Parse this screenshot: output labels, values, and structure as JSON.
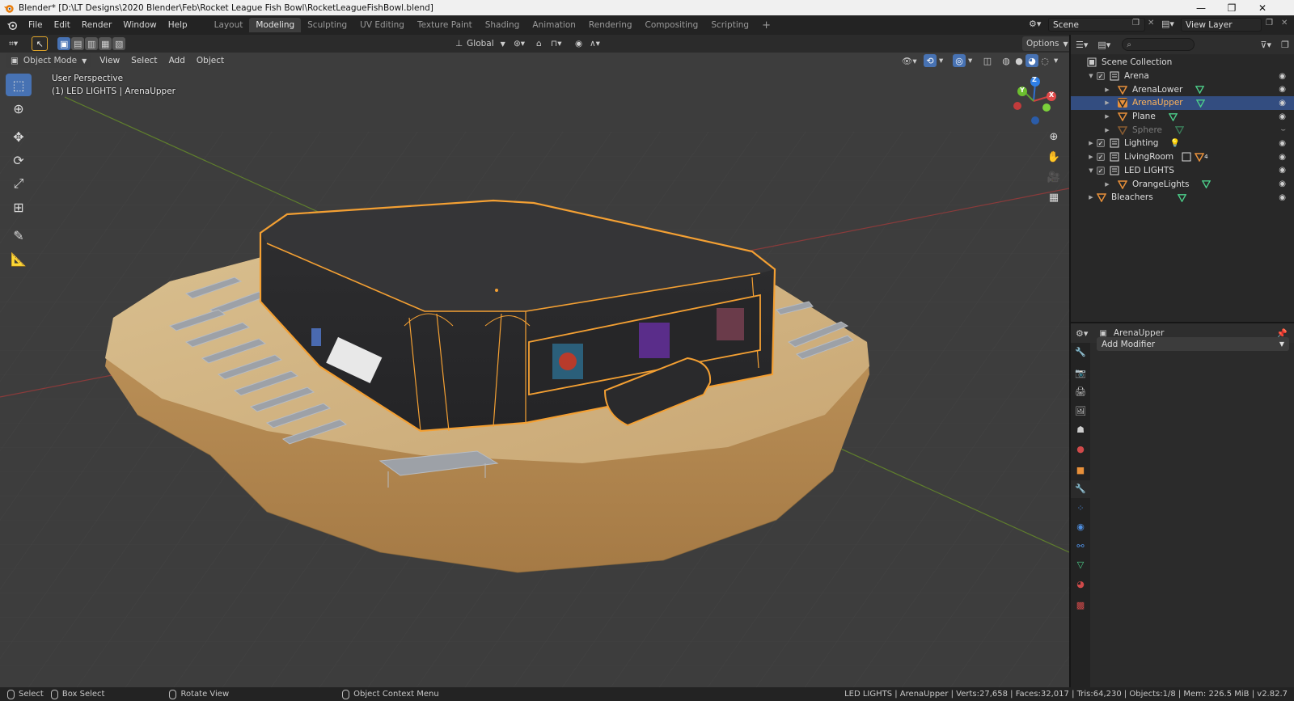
{
  "window": {
    "title": "Blender* [D:\\LT Designs\\2020 Blender\\Feb\\Rocket League Fish Bowl\\RocketLeagueFishBowl.blend]",
    "minimize": "—",
    "restore": "❐",
    "close": "✕"
  },
  "menu": [
    "File",
    "Edit",
    "Render",
    "Window",
    "Help"
  ],
  "workspaces": [
    "Layout",
    "Modeling",
    "Sculpting",
    "UV Editing",
    "Texture Paint",
    "Shading",
    "Animation",
    "Rendering",
    "Compositing",
    "Scripting"
  ],
  "active_workspace": "Modeling",
  "add_workspace": "+",
  "scene": {
    "label": "Scene",
    "view_layer": "View Layer"
  },
  "viewport_header": {
    "transform_orientation": "Global",
    "options": "Options",
    "mode": "Object Mode",
    "menus": [
      "View",
      "Select",
      "Add",
      "Object"
    ]
  },
  "viewport_overlay": {
    "perspective": "User Perspective",
    "collection_info": "(1) LED LIGHTS | ArenaUpper",
    "gizmo": {
      "z": "Z",
      "x": "X",
      "y": "Y"
    }
  },
  "outliner": {
    "root": "Scene Collection",
    "search_placeholder": "",
    "rows": [
      {
        "name": "Arena",
        "type": "collection",
        "depth": 1
      },
      {
        "name": "ArenaLower",
        "type": "object",
        "depth": 2
      },
      {
        "name": "ArenaUpper",
        "type": "object",
        "depth": 2,
        "selected": true
      },
      {
        "name": "Plane",
        "type": "object",
        "depth": 2
      },
      {
        "name": "Sphere",
        "type": "object",
        "depth": 2,
        "dim": true
      },
      {
        "name": "Lighting",
        "type": "collection",
        "depth": 1
      },
      {
        "name": "LivingRoom",
        "type": "collection",
        "depth": 1,
        "badge": "4"
      },
      {
        "name": "LED LIGHTS",
        "type": "collection",
        "depth": 1
      },
      {
        "name": "OrangeLights",
        "type": "object",
        "depth": 2
      },
      {
        "name": "Bleachers",
        "type": "object",
        "depth": 1
      }
    ]
  },
  "properties": {
    "object_name": "ArenaUpper",
    "add_modifier": "Add Modifier",
    "tab_icons": [
      "tool-icon",
      "render-icon",
      "output-icon",
      "view-layer-icon",
      "scene-icon",
      "world-icon",
      "object-icon",
      "modifier-icon",
      "particles-icon",
      "physics-icon",
      "constraints-icon",
      "data-icon",
      "material-icon",
      "texture-icon"
    ]
  },
  "statusbar": {
    "select": "Select",
    "box_select": "Box Select",
    "rotate_view": "Rotate View",
    "context_menu": "Object Context Menu",
    "stats": "LED LIGHTS | ArenaUpper | Verts:27,658 | Faces:32,017 | Tris:64,230 | Objects:1/8 | Mem: 226.5 MiB | v2.82.7"
  },
  "colors": {
    "accent_blue": "#4772b3",
    "selection_orange": "#f4a033",
    "viewport_bg": "#3d3d3d",
    "panel_bg": "#282828"
  }
}
